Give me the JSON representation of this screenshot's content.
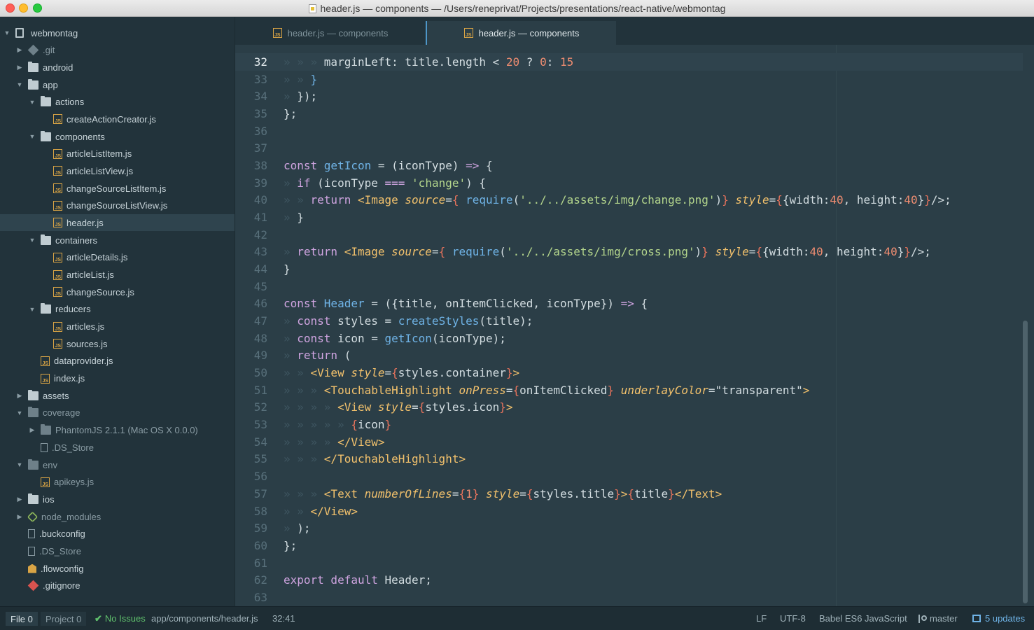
{
  "window": {
    "title": "header.js — components — /Users/reneprivat/Projects/presentations/react-native/webmontag"
  },
  "tree": [
    {
      "label": "webmontag",
      "level": 0,
      "type": "repo",
      "chev": "open"
    },
    {
      "label": ".git",
      "level": 1,
      "type": "git",
      "chev": "closed",
      "dim": true
    },
    {
      "label": "android",
      "level": 1,
      "type": "folder",
      "chev": "closed"
    },
    {
      "label": "app",
      "level": 1,
      "type": "folder",
      "chev": "open"
    },
    {
      "label": "actions",
      "level": 2,
      "type": "folder",
      "chev": "open"
    },
    {
      "label": "createActionCreator.js",
      "level": 3,
      "type": "js"
    },
    {
      "label": "components",
      "level": 2,
      "type": "folder",
      "chev": "open"
    },
    {
      "label": "articleListItem.js",
      "level": 3,
      "type": "js"
    },
    {
      "label": "articleListView.js",
      "level": 3,
      "type": "js"
    },
    {
      "label": "changeSourceListItem.js",
      "level": 3,
      "type": "js"
    },
    {
      "label": "changeSourceListView.js",
      "level": 3,
      "type": "js"
    },
    {
      "label": "header.js",
      "level": 3,
      "type": "js",
      "selected": true
    },
    {
      "label": "containers",
      "level": 2,
      "type": "folder",
      "chev": "open"
    },
    {
      "label": "articleDetails.js",
      "level": 3,
      "type": "js"
    },
    {
      "label": "articleList.js",
      "level": 3,
      "type": "js"
    },
    {
      "label": "changeSource.js",
      "level": 3,
      "type": "js"
    },
    {
      "label": "reducers",
      "level": 2,
      "type": "folder",
      "chev": "open"
    },
    {
      "label": "articles.js",
      "level": 3,
      "type": "js"
    },
    {
      "label": "sources.js",
      "level": 3,
      "type": "js"
    },
    {
      "label": "dataprovider.js",
      "level": 2,
      "type": "js"
    },
    {
      "label": "index.js",
      "level": 2,
      "type": "js"
    },
    {
      "label": "assets",
      "level": 1,
      "type": "folder",
      "chev": "closed"
    },
    {
      "label": "coverage",
      "level": 1,
      "type": "folder",
      "chev": "open",
      "dim": true
    },
    {
      "label": "PhantomJS 2.1.1 (Mac OS X 0.0.0)",
      "level": 2,
      "type": "folder",
      "chev": "closed",
      "dim": true
    },
    {
      "label": ".DS_Store",
      "level": 2,
      "type": "file",
      "dim": true
    },
    {
      "label": "env",
      "level": 1,
      "type": "folder",
      "chev": "open",
      "dim": true
    },
    {
      "label": "apikeys.js",
      "level": 2,
      "type": "js",
      "dim": true
    },
    {
      "label": "ios",
      "level": 1,
      "type": "folder",
      "chev": "closed"
    },
    {
      "label": "node_modules",
      "level": 1,
      "type": "node",
      "chev": "closed",
      "dim": true
    },
    {
      "label": ".buckconfig",
      "level": 1,
      "type": "file"
    },
    {
      "label": ".DS_Store",
      "level": 1,
      "type": "file",
      "dim": true
    },
    {
      "label": ".flowconfig",
      "level": 1,
      "type": "flow"
    },
    {
      "label": ".gitignore",
      "level": 1,
      "type": "gitred"
    }
  ],
  "tabs": [
    {
      "label": "header.js — components",
      "active": false
    },
    {
      "label": "header.js — components",
      "active": true
    }
  ],
  "editor": {
    "current_line": 32,
    "lines": [
      {
        "n": "32",
        "g": "» » » ",
        "t": [
          [
            "pl",
            "marginLeft: title.length < "
          ],
          [
            "n",
            "20"
          ],
          [
            "pl",
            " ? "
          ],
          [
            "n",
            "0"
          ],
          [
            "pl",
            ": "
          ],
          [
            "n",
            "15"
          ]
        ]
      },
      {
        "n": "33",
        "g": "» » ",
        "t": [
          [
            "f",
            "}"
          ]
        ]
      },
      {
        "n": "34",
        "g": "» ",
        "t": [
          [
            "pl",
            "});"
          ]
        ]
      },
      {
        "n": "35",
        "g": "",
        "t": [
          [
            "pl",
            "};"
          ]
        ]
      },
      {
        "n": "36",
        "g": "",
        "t": []
      },
      {
        "n": "37",
        "g": "",
        "t": []
      },
      {
        "n": "38",
        "g": "",
        "t": [
          [
            "k",
            "const "
          ],
          [
            "f",
            "getIcon"
          ],
          [
            "pl",
            " = (iconType) "
          ],
          [
            "k",
            "=>"
          ],
          [
            "pl",
            " {"
          ]
        ]
      },
      {
        "n": "39",
        "g": "» ",
        "t": [
          [
            "k",
            "if"
          ],
          [
            "pl",
            " (iconType "
          ],
          [
            "k",
            "==="
          ],
          [
            "pl",
            " "
          ],
          [
            "s",
            "'change'"
          ],
          [
            "pl",
            ") {"
          ]
        ]
      },
      {
        "n": "40",
        "g": "» » ",
        "t": [
          [
            "k",
            "return "
          ],
          [
            "tg",
            "<Image "
          ],
          [
            "at",
            "source"
          ],
          [
            "pl",
            "="
          ],
          [
            "br",
            "{"
          ],
          [
            "pl",
            " "
          ],
          [
            "f",
            "require"
          ],
          [
            "pl",
            "("
          ],
          [
            "s",
            "'../../assets/img/change.png'"
          ],
          [
            "pl",
            ")"
          ],
          [
            "br",
            "}"
          ],
          [
            "pl",
            " "
          ],
          [
            "at",
            "style"
          ],
          [
            "pl",
            "="
          ],
          [
            "br",
            "{"
          ],
          [
            "pl",
            "{width:"
          ],
          [
            "n",
            "40"
          ],
          [
            "pl",
            ", height:"
          ],
          [
            "n",
            "40"
          ],
          [
            "pl",
            "}"
          ],
          [
            "br",
            "}"
          ],
          [
            "pl",
            "/>;"
          ]
        ]
      },
      {
        "n": "41",
        "g": "» ",
        "t": [
          [
            "pl",
            "}"
          ]
        ]
      },
      {
        "n": "42",
        "g": "",
        "t": []
      },
      {
        "n": "43",
        "g": "» ",
        "t": [
          [
            "k",
            "return "
          ],
          [
            "tg",
            "<Image "
          ],
          [
            "at",
            "source"
          ],
          [
            "pl",
            "="
          ],
          [
            "br",
            "{"
          ],
          [
            "pl",
            " "
          ],
          [
            "f",
            "require"
          ],
          [
            "pl",
            "("
          ],
          [
            "s",
            "'../../assets/img/cross.png'"
          ],
          [
            "pl",
            ")"
          ],
          [
            "br",
            "}"
          ],
          [
            "pl",
            " "
          ],
          [
            "at",
            "style"
          ],
          [
            "pl",
            "="
          ],
          [
            "br",
            "{"
          ],
          [
            "pl",
            "{width:"
          ],
          [
            "n",
            "40"
          ],
          [
            "pl",
            ", height:"
          ],
          [
            "n",
            "40"
          ],
          [
            "pl",
            "}"
          ],
          [
            "br",
            "}"
          ],
          [
            "pl",
            "/>;"
          ]
        ]
      },
      {
        "n": "44",
        "g": "",
        "t": [
          [
            "pl",
            "}"
          ]
        ]
      },
      {
        "n": "45",
        "g": "",
        "t": []
      },
      {
        "n": "46",
        "g": "",
        "t": [
          [
            "k",
            "const "
          ],
          [
            "f",
            "Header"
          ],
          [
            "pl",
            " = ({title, onItemClicked, iconType}) "
          ],
          [
            "k",
            "=>"
          ],
          [
            "pl",
            " {"
          ]
        ]
      },
      {
        "n": "47",
        "g": "» ",
        "t": [
          [
            "k",
            "const "
          ],
          [
            "pl",
            "styles = "
          ],
          [
            "f",
            "createStyles"
          ],
          [
            "pl",
            "(title);"
          ]
        ]
      },
      {
        "n": "48",
        "g": "» ",
        "t": [
          [
            "k",
            "const "
          ],
          [
            "pl",
            "icon = "
          ],
          [
            "f",
            "getIcon"
          ],
          [
            "pl",
            "(iconType);"
          ]
        ]
      },
      {
        "n": "49",
        "g": "» ",
        "t": [
          [
            "k",
            "return "
          ],
          [
            "pl",
            "("
          ]
        ]
      },
      {
        "n": "50",
        "g": "» » ",
        "t": [
          [
            "tg",
            "<View "
          ],
          [
            "at",
            "style"
          ],
          [
            "pl",
            "="
          ],
          [
            "br",
            "{"
          ],
          [
            "pl",
            "styles.container"
          ],
          [
            "br",
            "}"
          ],
          [
            "tg",
            ">"
          ]
        ]
      },
      {
        "n": "51",
        "g": "» » » ",
        "t": [
          [
            "tg",
            "<TouchableHighlight "
          ],
          [
            "at",
            "onPress"
          ],
          [
            "pl",
            "="
          ],
          [
            "br",
            "{"
          ],
          [
            "pl",
            "onItemClicked"
          ],
          [
            "br",
            "}"
          ],
          [
            "pl",
            " "
          ],
          [
            "at",
            "underlayColor"
          ],
          [
            "pl",
            "=\"transparent\""
          ],
          [
            "tg",
            ">"
          ]
        ]
      },
      {
        "n": "52",
        "g": "» » » » ",
        "t": [
          [
            "tg",
            "<View "
          ],
          [
            "at",
            "style"
          ],
          [
            "pl",
            "="
          ],
          [
            "br",
            "{"
          ],
          [
            "pl",
            "styles.icon"
          ],
          [
            "br",
            "}"
          ],
          [
            "tg",
            ">"
          ]
        ]
      },
      {
        "n": "53",
        "g": "» » » » » ",
        "t": [
          [
            "br",
            "{"
          ],
          [
            "pl",
            "icon"
          ],
          [
            "br",
            "}"
          ]
        ]
      },
      {
        "n": "54",
        "g": "» » » » ",
        "t": [
          [
            "tg",
            "</View>"
          ]
        ]
      },
      {
        "n": "55",
        "g": "» » » ",
        "t": [
          [
            "tg",
            "</TouchableHighlight>"
          ]
        ]
      },
      {
        "n": "56",
        "g": "",
        "t": []
      },
      {
        "n": "57",
        "g": "» » » ",
        "t": [
          [
            "tg",
            "<Text "
          ],
          [
            "at",
            "numberOfLines"
          ],
          [
            "pl",
            "="
          ],
          [
            "br",
            "{"
          ],
          [
            "n",
            "1"
          ],
          [
            "br",
            "}"
          ],
          [
            "pl",
            " "
          ],
          [
            "at",
            "style"
          ],
          [
            "pl",
            "="
          ],
          [
            "br",
            "{"
          ],
          [
            "pl",
            "styles.title"
          ],
          [
            "br",
            "}"
          ],
          [
            "tg",
            ">"
          ],
          [
            "br",
            "{"
          ],
          [
            "pl",
            "title"
          ],
          [
            "br",
            "}"
          ],
          [
            "tg",
            "</Text>"
          ]
        ]
      },
      {
        "n": "58",
        "g": "» » ",
        "t": [
          [
            "tg",
            "</View>"
          ]
        ]
      },
      {
        "n": "59",
        "g": "» ",
        "t": [
          [
            "pl",
            ");"
          ]
        ]
      },
      {
        "n": "60",
        "g": "",
        "t": [
          [
            "pl",
            "};"
          ]
        ]
      },
      {
        "n": "61",
        "g": "",
        "t": []
      },
      {
        "n": "62",
        "g": "",
        "t": [
          [
            "k",
            "export default "
          ],
          [
            "pl",
            "Header;"
          ]
        ]
      },
      {
        "n": "63",
        "g": "",
        "t": []
      }
    ]
  },
  "status": {
    "file_label": "File",
    "file_count": "0",
    "project_label": "Project",
    "project_count": "0",
    "issues": "No Issues",
    "path": "app/components/header.js",
    "cursor": "32:41",
    "line_ending": "LF",
    "encoding": "UTF-8",
    "grammar": "Babel ES6 JavaScript",
    "branch": "master",
    "updates": "5 updates"
  },
  "colors": {
    "keyword": "#cfa4e0",
    "function": "#6fb3e6",
    "string": "#b3d58c",
    "number": "#f08d71",
    "tag": "#f2c16c",
    "accent": "#4e96c8"
  }
}
